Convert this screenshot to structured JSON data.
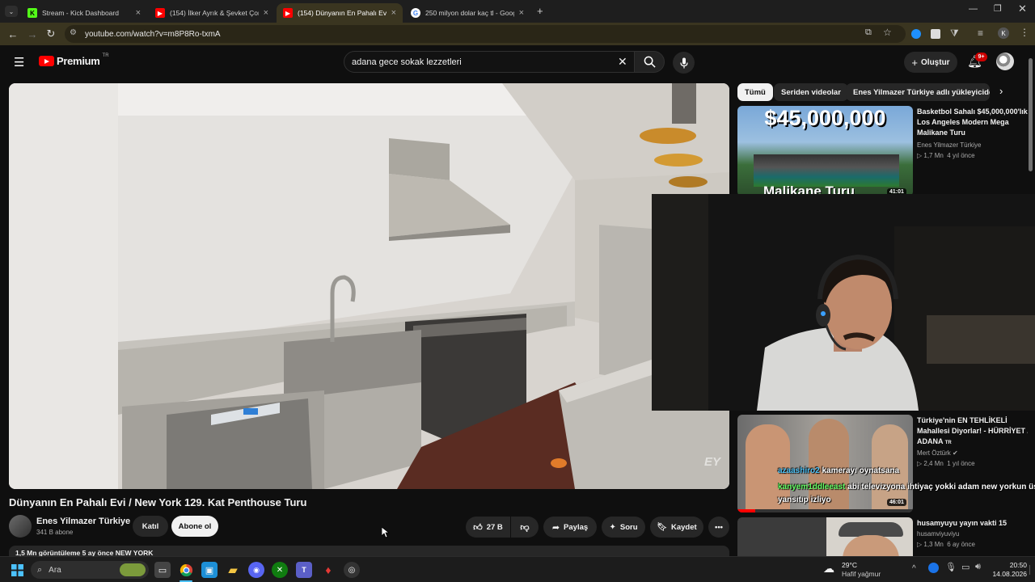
{
  "tabs": [
    {
      "title": "Stream - Kick Dashboard",
      "favicon": "kick-icon"
    },
    {
      "title": "(154) İlker Ayrık & Şevket Çoruh",
      "favicon": "youtube-icon"
    },
    {
      "title": "(154) Dünyanın En Pahalı Evi / N",
      "favicon": "youtube-icon"
    },
    {
      "title": "250 milyon dolar kaç tl - Google",
      "favicon": "google-icon"
    }
  ],
  "browser": {
    "url": "youtube.com/watch?v=m8P8Ro-txmA",
    "profile_initial": "K"
  },
  "youtube": {
    "logo_text": "Premium",
    "region": "TR",
    "search_value": "adana gece sokak lezzetleri",
    "create_label": "Oluştur",
    "notif_count": "9+"
  },
  "video": {
    "title": "Dünyanın En Pahalı Evi / New York 129. Kat Penthouse Turu",
    "channel": "Enes Yilmazer Türkiye",
    "subscribers": "341 B abone",
    "join_label": "Katıl",
    "subscribe_label": "Abone ol",
    "likes": "27 B",
    "share_label": "Paylaş",
    "ask_label": "Soru",
    "save_label": "Kaydet",
    "watermark": "EY",
    "description_partial": "1,5 Mn görüntüleme  5 ay önce  NEW YORK"
  },
  "chips": [
    "Tümü",
    "Seriden videolar",
    "Enes Yilmazer Türkiye adlı yükleyiciden"
  ],
  "recommendations": [
    {
      "thumb_text": "$45,000,000",
      "thumb_sub": "Malikane Turu",
      "duration": "41:01",
      "title": "Basketbol Sahalı $45,000,000'lık Los Angeles Modern Mega Malikane Turu",
      "channel": "Enes Yilmazer Türkiye",
      "views": "1,7 Mn",
      "age": "4 yıl önce"
    },
    {
      "duration": "46:01",
      "title": "Türkiye'nin EN TEHLİKELİ Mahallesi Diyorlar! - HÜRRİYET / ADANA",
      "title_badge": "TR",
      "channel": "Mert Öztürk",
      "views": "2,4 Mn",
      "age": "1 yıl önce"
    },
    {
      "title": "husamyuyu yayın vakti 15",
      "channel": "husamviyuviyu",
      "views": "1,3 Mn",
      "age": "6 ay önce"
    }
  ],
  "chat_overlay": [
    {
      "user": "azaashiro2",
      "message": " kamerayı oynatsana",
      "user_color": "#4fc3f7"
    },
    {
      "user": "kanyem1ddleeast",
      "message": " abi televizyona ihtiyaç yokki adam new yorkun üstünde",
      "user_color": "#66ff66"
    },
    {
      "user": "",
      "message": "yansıtıp izliyo",
      "user_color": "#ffffff"
    }
  ],
  "taskbar": {
    "search_placeholder": "Ara",
    "weather_temp": "29°C",
    "weather_desc": "Hafif yağmur",
    "time": "20:50",
    "date": "14.08.2026"
  },
  "colors": {
    "yt_red": "#ff0000",
    "chrome_accent": "#3a3520"
  }
}
